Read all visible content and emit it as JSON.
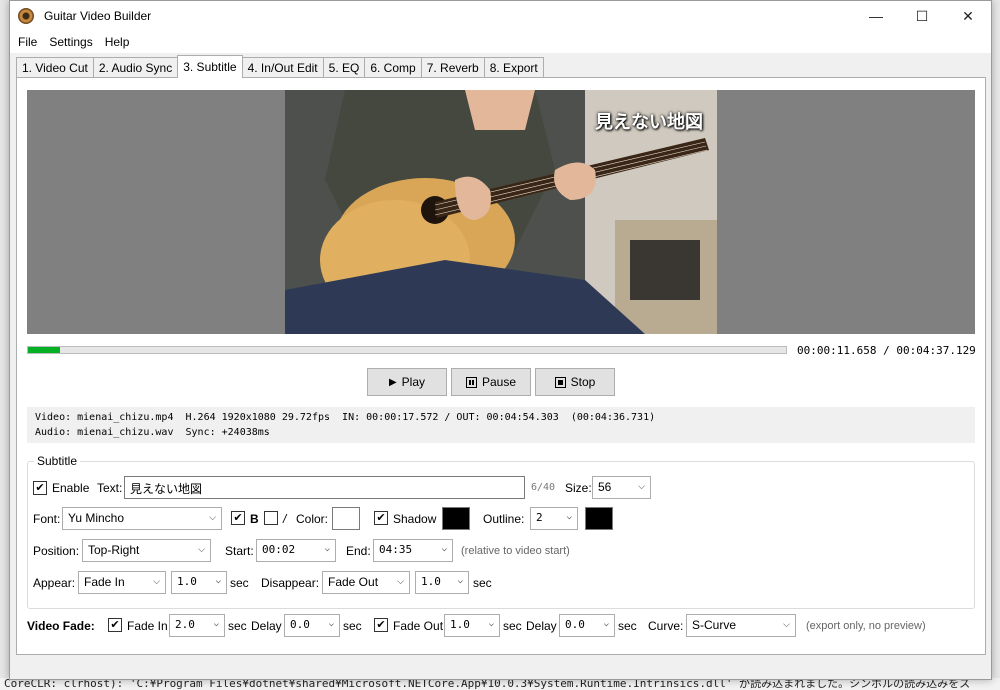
{
  "window": {
    "title": "Guitar Video Builder",
    "controls": {
      "minimize": "—",
      "maximize": "☐",
      "close": "✕"
    }
  },
  "menu": [
    "File",
    "Settings",
    "Help"
  ],
  "tabs": [
    "1. Video Cut",
    "2. Audio Sync",
    "3. Subtitle",
    "4. In/Out Edit",
    "5. EQ",
    "6. Comp",
    "7. Reverb",
    "8. Export"
  ],
  "active_tab": "3. Subtitle",
  "preview": {
    "subtitle_overlay": "見えない地図",
    "progress_fraction": 0.0418,
    "time": "00:00:11.658 / 00:04:37.129"
  },
  "transport": {
    "play": "Play",
    "pause": "Pause",
    "stop": "Stop"
  },
  "info": {
    "video_line": "Video: mienai_chizu.mp4  H.264 1920x1080 29.72fps  IN: 00:00:17.572 / OUT: 00:04:54.303  (00:04:36.731)",
    "audio_line": "Audio: mienai_chizu.wav  Sync: +24038ms"
  },
  "subtitle": {
    "group_title": "Subtitle",
    "enable_label": "Enable",
    "enable_checked": true,
    "text_label": "Text:",
    "text_value": "見えない地図",
    "char_count": "6/40",
    "size_label": "Size:",
    "size_value": "56",
    "font_label": "Font:",
    "font_value": "Yu Mincho",
    "bold_label": "B",
    "bold_checked": true,
    "italic_label": "/",
    "italic_checked": false,
    "color_label": "Color:",
    "text_color": "#ffffff",
    "shadow_label": "Shadow",
    "shadow_checked": true,
    "shadow_color": "#000000",
    "outline_label": "Outline:",
    "outline_value": "2",
    "outline_color": "#000000",
    "position_label": "Position:",
    "position_value": "Top-Right",
    "start_label": "Start:",
    "start_value": "00:02",
    "end_label": "End:",
    "end_value": "04:35",
    "relative_hint": "(relative to video start)",
    "appear_label": "Appear:",
    "appear_value": "Fade In",
    "appear_duration": "1.0",
    "sec_label": "sec",
    "disappear_label": "Disappear:",
    "disappear_value": "Fade Out",
    "disappear_duration": "1.0"
  },
  "video_fade": {
    "label": "Video Fade:",
    "fade_in_label": "Fade In",
    "fade_in_checked": true,
    "fade_in_value": "2.0",
    "sec_label": "sec",
    "delay_label": "Delay",
    "fade_in_delay": "0.0",
    "fade_out_label": "Fade Out",
    "fade_out_checked": true,
    "fade_out_value": "1.0",
    "fade_out_delay": "0.0",
    "curve_label": "Curve:",
    "curve_value": "S-Curve",
    "export_hint": "(export only, no preview)"
  },
  "console_text": "CoreCLR: clrhost): 'C:¥Program Files¥dotnet¥shared¥Microsoft.NETCore.App¥10.0.3¥System.Runtime.Intrinsics.dll' が読み込まれました。シンボルの読み込みをス"
}
